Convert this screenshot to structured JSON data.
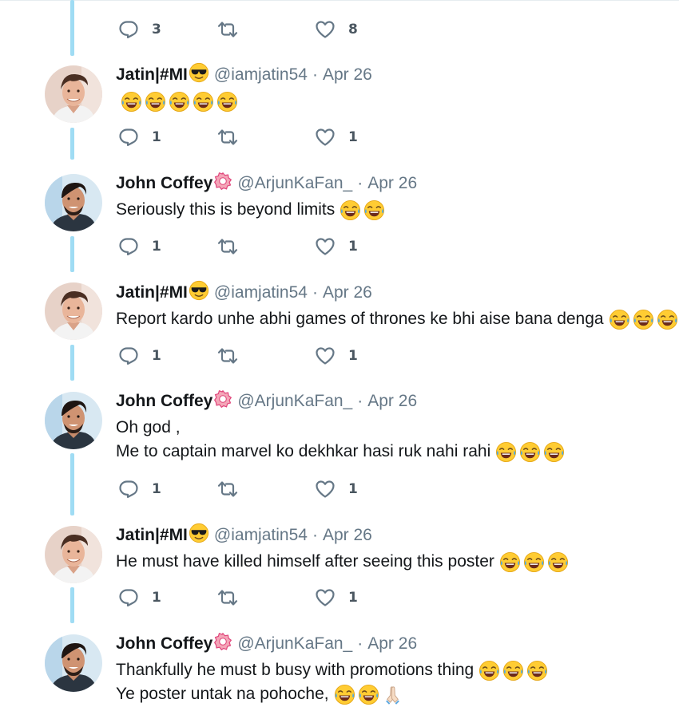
{
  "colors": {
    "thread_line": "#9fdcf4",
    "icon_gray": "#657786",
    "count_gray": "#4a5660",
    "name_black": "#14171a",
    "meta_gray": "#657786",
    "emoji_yellow": "#ffcc33"
  },
  "top_actions": {
    "reply_count": "3",
    "retweet_count": "",
    "like_count": "8"
  },
  "tweets": [
    {
      "name": "Jatin|#MI",
      "name_emoji": "sunglasses-emoji",
      "handle": "@iamjatin54",
      "separator": "·",
      "date": "Apr 26",
      "lines": [
        {
          "text": "",
          "laugh_emojis": 5
        }
      ],
      "reply_count": "1",
      "retweet_count": "",
      "like_count": "1",
      "avatar": "avatar-jatin"
    },
    {
      "name": "John Coffey",
      "name_emoji": "badge-emoji",
      "handle": "@ArjunKaFan_",
      "separator": "·",
      "date": "Apr 26",
      "lines": [
        {
          "text": "Seriously this is beyond limits",
          "laugh_emojis": 2
        }
      ],
      "reply_count": "1",
      "retweet_count": "",
      "like_count": "1",
      "avatar": "avatar-john"
    },
    {
      "name": "Jatin|#MI",
      "name_emoji": "sunglasses-emoji",
      "handle": "@iamjatin54",
      "separator": "·",
      "date": "Apr 26",
      "lines": [
        {
          "text": "Report kardo unhe abhi games of thrones ke bhi aise bana denga",
          "laugh_emojis": 3
        }
      ],
      "reply_count": "1",
      "retweet_count": "",
      "like_count": "1",
      "avatar": "avatar-jatin"
    },
    {
      "name": "John Coffey",
      "name_emoji": "badge-emoji",
      "handle": "@ArjunKaFan_",
      "separator": "·",
      "date": "Apr 26",
      "lines": [
        {
          "text": "Oh god ,",
          "laugh_emojis": 0
        },
        {
          "text": "Me to captain marvel ko dekhkar hasi ruk nahi rahi",
          "laugh_emojis": 3
        }
      ],
      "reply_count": "1",
      "retweet_count": "",
      "like_count": "1",
      "avatar": "avatar-john"
    },
    {
      "name": "Jatin|#MI",
      "name_emoji": "sunglasses-emoji",
      "handle": "@iamjatin54",
      "separator": "·",
      "date": "Apr 26",
      "lines": [
        {
          "text": "He must have killed himself after seeing this poster",
          "laugh_emojis": 3
        }
      ],
      "reply_count": "1",
      "retweet_count": "",
      "like_count": "1",
      "avatar": "avatar-jatin"
    },
    {
      "name": "John Coffey",
      "name_emoji": "badge-emoji",
      "handle": "@ArjunKaFan_",
      "separator": "·",
      "date": "Apr 26",
      "lines": [
        {
          "text": "Thankfully he must b busy with promotions thing",
          "laugh_emojis": 3
        },
        {
          "text": "Ye poster untak na pohoche,",
          "laugh_emojis": 2,
          "trailing_emoji": "folded-hands-emoji"
        }
      ],
      "reply_count": "",
      "retweet_count": "",
      "like_count": "",
      "avatar": "avatar-john"
    }
  ]
}
